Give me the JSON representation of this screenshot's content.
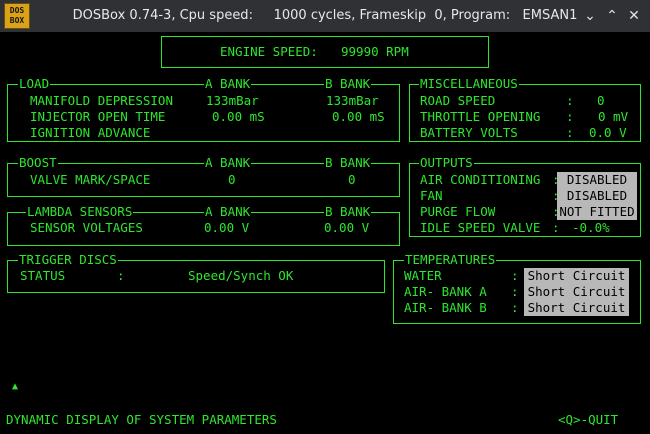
{
  "window": {
    "app_icon_text_1": "DOS",
    "app_icon_text_2": "BOX",
    "title": "DOSBox 0.74-3, Cpu speed:     1000 cycles, Frameskip  0, Program:   EMSAN1",
    "minimize_icon": "chevron-down-icon",
    "maximize_icon": "chevron-up-icon",
    "close_icon": "close-icon"
  },
  "engine": {
    "label": "ENGINE SPEED:",
    "value": "99990 RPM"
  },
  "load": {
    "title": "LOAD",
    "a_bank": "A BANK",
    "b_bank": "B BANK",
    "rows": [
      {
        "label": "MANIFOLD DEPRESSION",
        "a": "133mBar",
        "b": "133mBar"
      },
      {
        "label": "INJECTOR OPEN TIME",
        "a": "0.00 mS",
        "b": "0.00 mS"
      },
      {
        "label": "IGNITION ADVANCE",
        "a": "",
        "b": ""
      }
    ]
  },
  "misc": {
    "title": "MISCELLANEOUS",
    "rows": [
      {
        "label": "ROAD SPEED",
        "sep": ":",
        "value": "0"
      },
      {
        "label": "THROTTLE OPENING",
        "sep": ":",
        "value": "0 mV"
      },
      {
        "label": "BATTERY VOLTS",
        "sep": ":",
        "value": "0.0 V"
      }
    ]
  },
  "boost": {
    "title": "BOOST",
    "a_bank": "A BANK",
    "b_bank": "B BANK",
    "row": {
      "label": "VALVE MARK/SPACE",
      "a": "0",
      "b": "0"
    }
  },
  "outputs": {
    "title": "OUTPUTS",
    "rows": [
      {
        "label": "AIR CONDITIONING",
        "sep": ":",
        "value": "DISABLED"
      },
      {
        "label": "FAN",
        "sep": ":",
        "value": "DISABLED"
      },
      {
        "label": "PURGE FLOW",
        "sep": ":",
        "value": "NOT FITTED"
      },
      {
        "label": "IDLE SPEED VALVE",
        "sep": ":",
        "value": "-0.0%"
      }
    ]
  },
  "lambda": {
    "title": "LAMBDA SENSORS",
    "a_bank": "A BANK",
    "b_bank": "B BANK",
    "row": {
      "label": "SENSOR VOLTAGES",
      "a": "0.00 V",
      "b": "0.00 V"
    }
  },
  "trigger": {
    "title": "TRIGGER DISCS",
    "row": {
      "label": "STATUS",
      "sep": ":",
      "value": "Speed/Synch OK"
    }
  },
  "temps": {
    "title": "TEMPERATURES",
    "rows": [
      {
        "label": "WATER",
        "sep": ":",
        "value": "Short Circuit"
      },
      {
        "label": "AIR- BANK A",
        "sep": ":",
        "value": "Short Circuit"
      },
      {
        "label": "AIR- BANK B",
        "sep": ":",
        "value": "Short Circuit"
      }
    ]
  },
  "footer": {
    "cursor": "▲",
    "status": "DYNAMIC DISPLAY OF SYSTEM PARAMETERS",
    "quit": "<Q>-QUIT"
  },
  "colors": {
    "text": "#2ee62e",
    "background": "#000000",
    "highlight": "#b8b8b8"
  }
}
